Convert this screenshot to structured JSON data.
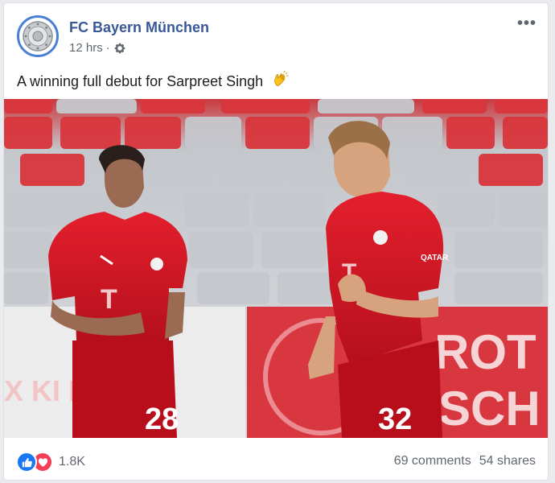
{
  "post": {
    "page_name": "FC Bayern München",
    "timestamp": "12 hrs",
    "separator": "·",
    "privacy_icon": "gear-icon",
    "caption": "A winning full debut for Sarpreet Singh",
    "caption_emoji": "clapping-hands-icon",
    "more_icon": "more-options-icon",
    "more_label": "•••"
  },
  "photo": {
    "description_icons": [
      "stadium-seats",
      "player-28",
      "player-32"
    ],
    "left_player_number": "28",
    "right_player_number": "32",
    "sponsor_left": "T",
    "sponsor_right": "T",
    "sleeve_text": "QATAR",
    "banner_text_right_1": "ROT",
    "banner_text_right_2": "SCH",
    "banner_text_left": "X KI N"
  },
  "engagement": {
    "reaction_count": "1.8K",
    "comments": "69 comments",
    "shares": "54 shares"
  },
  "colors": {
    "link_blue": "#385898",
    "like_blue": "#1877f2",
    "love_red": "#f33e58",
    "bayern_red": "#d3102a"
  }
}
